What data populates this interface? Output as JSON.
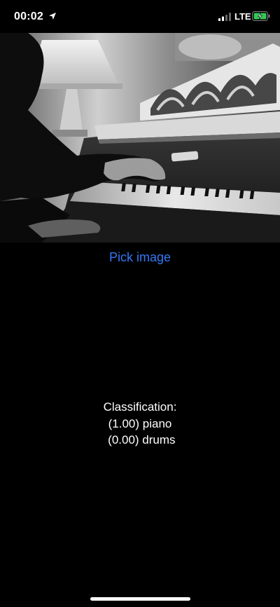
{
  "status_bar": {
    "time": "00:02",
    "network": "LTE",
    "location_icon": "location-arrow-icon",
    "signal_icon": "cellular-signal-icon",
    "battery_icon": "battery-charging-icon",
    "battery_color": "#34c759"
  },
  "image": {
    "subject_icon": "piano-photo",
    "description_visible": false
  },
  "pick_button": {
    "label": "Pick image",
    "color": "#3478f6"
  },
  "classification": {
    "heading": "Classification:",
    "results": [
      {
        "text": "(1.00) piano"
      },
      {
        "text": " (0.00) drums"
      }
    ]
  }
}
